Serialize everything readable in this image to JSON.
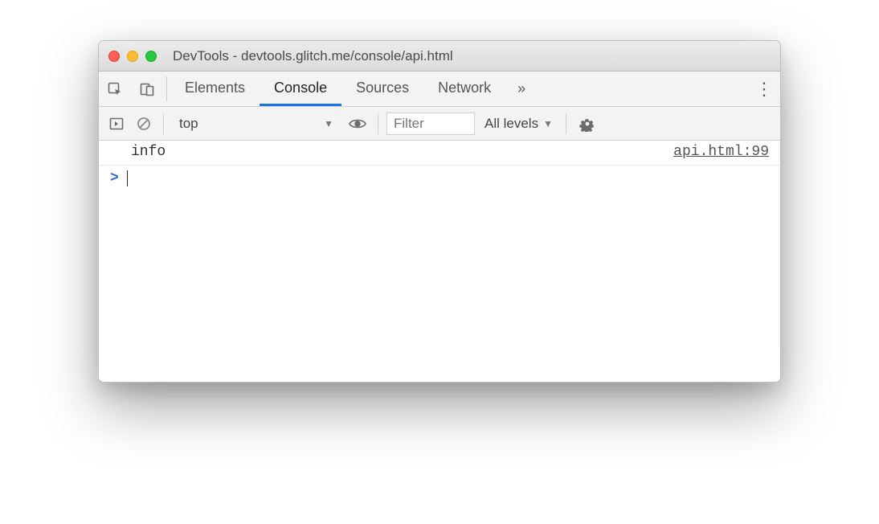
{
  "window": {
    "title": "DevTools - devtools.glitch.me/console/api.html"
  },
  "tabs": {
    "items": [
      "Elements",
      "Console",
      "Sources",
      "Network"
    ],
    "active_index": 1
  },
  "toolbar": {
    "context": "top",
    "filter_placeholder": "Filter",
    "levels_label": "All levels"
  },
  "console": {
    "rows": [
      {
        "message": "info",
        "source": "api.html:99"
      }
    ],
    "prompt": ">"
  }
}
